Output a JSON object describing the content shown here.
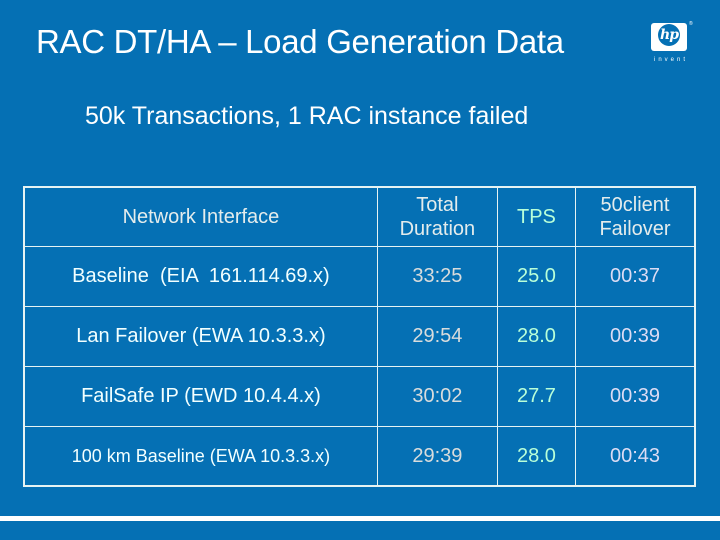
{
  "slide": {
    "title": "RAC DT/HA – Load Generation Data",
    "subtitle": "50k Transactions, 1 RAC instance failed",
    "logo": {
      "mark": "hp",
      "tagline": "invent",
      "icon": "hp-logo-icon"
    }
  },
  "colors": {
    "background": "#0570b4",
    "text": "#ffffff",
    "tps_column": "#b8ffd9",
    "duration_column": "#d9dcdc",
    "failover_column": "#dcdcf4"
  },
  "table": {
    "headers": [
      "Network Interface",
      "Total Duration",
      "TPS",
      "50client Failover"
    ],
    "rows": [
      {
        "interface": "Baseline  (EIA  161.114.69.x)",
        "duration": "33:25",
        "tps": "25.0",
        "failover": "00:37"
      },
      {
        "interface": "Lan Failover (EWA 10.3.3.x)",
        "duration": "29:54",
        "tps": "28.0",
        "failover": "00:39"
      },
      {
        "interface": "FailSafe IP (EWD 10.4.4.x)",
        "duration": "30:02",
        "tps": "27.7",
        "failover": "00:39"
      },
      {
        "interface": "100 km Baseline (EWA 10.3.3.x)",
        "duration": "29:39",
        "tps": "28.0",
        "failover": "00:43"
      }
    ]
  }
}
